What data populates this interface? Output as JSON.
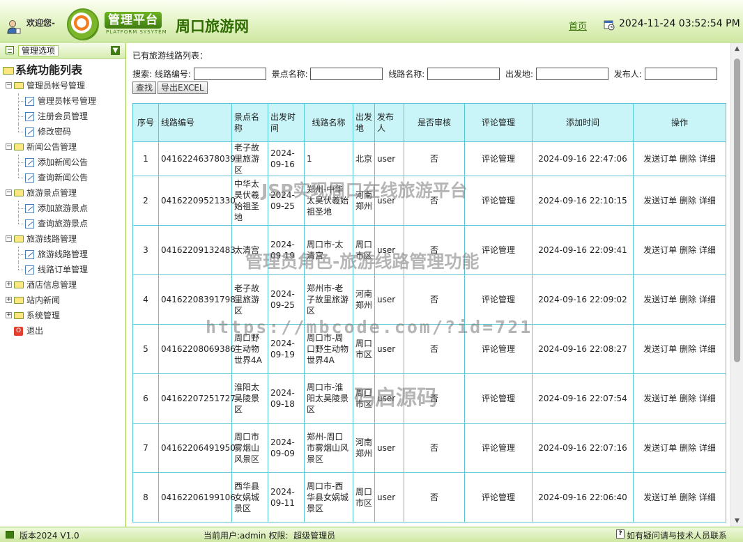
{
  "header": {
    "welcome": "欢迎您-",
    "platform_cn": "管理平台",
    "platform_en": "PLATFORM SYSYTEM",
    "site_title": "周口旅游网",
    "home_link": "首页",
    "datetime": "2024-11-24 03:52:54 PM"
  },
  "sidebar": {
    "menu_label": "管理选项",
    "tree_root": "系统功能列表",
    "groups": [
      {
        "label": "管理员帐号管理",
        "items": [
          "管理员帐号管理",
          "注册会员管理",
          "修改密码"
        ]
      },
      {
        "label": "新闻公告管理",
        "items": [
          "添加新闻公告",
          "查询新闻公告"
        ]
      },
      {
        "label": "旅游景点管理",
        "items": [
          "添加旅游景点",
          "查询旅游景点"
        ]
      },
      {
        "label": "旅游线路管理",
        "items": [
          "旅游线路管理",
          "线路订单管理"
        ]
      },
      {
        "label": "酒店信息管理",
        "items": []
      },
      {
        "label": "站内新闻",
        "items": []
      },
      {
        "label": "系统管理",
        "items": []
      }
    ],
    "exit": "退出"
  },
  "main": {
    "list_title": "已有旅游线路列表：",
    "search": {
      "label": "搜索:",
      "fields": [
        {
          "label": "线路编号:",
          "value": ""
        },
        {
          "label": "景点名称:",
          "value": ""
        },
        {
          "label": "线路名称:",
          "value": ""
        },
        {
          "label": "出发地:",
          "value": ""
        },
        {
          "label": "发布人:",
          "value": ""
        }
      ],
      "find_button": "查找",
      "export_button": "导出EXCEL"
    },
    "table": {
      "headers": [
        "序号",
        "线路编号",
        "景点名称",
        "出发时间",
        "线路名称",
        "出发地",
        "发布人",
        "是否审核",
        "评论管理",
        "添加时间",
        "操作"
      ],
      "rows": [
        {
          "no": "1",
          "code": "04162246378039",
          "spot": "老子故里旅游区",
          "date": "2024-09-16",
          "route": "1",
          "origin": "北京",
          "publisher": "user",
          "audit": "否",
          "comment": "评论管理",
          "added": "2024-09-16 22:47:06"
        },
        {
          "no": "2",
          "code": "04162209521330",
          "spot": "中华太昊伏羲始祖圣地",
          "date": "2024-09-25",
          "route": "郑州-中华太昊伏羲始祖圣地",
          "origin": "河南郑州",
          "publisher": "user",
          "audit": "否",
          "comment": "评论管理",
          "added": "2024-09-16 22:10:15"
        },
        {
          "no": "3",
          "code": "04162209132483",
          "spot": "太清宫",
          "date": "2024-09-19",
          "route": "周口市-太清宫",
          "origin": "周口市区",
          "publisher": "user",
          "audit": "否",
          "comment": "评论管理",
          "added": "2024-09-16 22:09:41"
        },
        {
          "no": "4",
          "code": "04162208391798",
          "spot": "老子故里旅游区",
          "date": "2024-09-25",
          "route": "郑州市-老子故里旅游区",
          "origin": "河南郑州",
          "publisher": "user",
          "audit": "否",
          "comment": "评论管理",
          "added": "2024-09-16 22:09:02"
        },
        {
          "no": "5",
          "code": "04162208069386",
          "spot": "周口野生动物世界4A",
          "date": "2024-09-19",
          "route": "周口市-周口野生动物世界4A",
          "origin": "周口市区",
          "publisher": "user",
          "audit": "否",
          "comment": "评论管理",
          "added": "2024-09-16 22:08:27"
        },
        {
          "no": "6",
          "code": "04162207251727",
          "spot": "淮阳太昊陵景区",
          "date": "2024-09-18",
          "route": "周口市-淮阳太昊陵景区",
          "origin": "周口市区",
          "publisher": "user",
          "audit": "否",
          "comment": "评论管理",
          "added": "2024-09-16 22:07:54"
        },
        {
          "no": "7",
          "code": "04162206491950",
          "spot": "周口市雾烟山风景区",
          "date": "2024-09-09",
          "route": "郑州-周口市雾烟山风景区",
          "origin": "河南郑州",
          "publisher": "user",
          "audit": "否",
          "comment": "评论管理",
          "added": "2024-09-16 22:07:16"
        },
        {
          "no": "8",
          "code": "04162206199106",
          "spot": "西华县女娲城景区",
          "date": "2024-09-11",
          "route": "周口市-西华县女娲城景区",
          "origin": "周口市区",
          "publisher": "user",
          "audit": "否",
          "comment": "评论管理",
          "added": "2024-09-16 22:06:40"
        }
      ],
      "ops": [
        "发送订单",
        "删除",
        "详细"
      ]
    }
  },
  "watermarks": [
    "JSP实现周口在线旅游平台",
    "管理员角色-旅游线路管理功能",
    "https://mbcode.com/?id=721",
    "码启源码"
  ],
  "footer": {
    "version": "版本2024 V1.0",
    "current_user": "当前用户:admin 权限:  超级管理员",
    "help": "如有疑问请与技术人员联系"
  },
  "colors": {
    "header_green": "#2e6b00",
    "table_border": "#57c8d3",
    "table_header_bg": "#c9f4f8"
  }
}
